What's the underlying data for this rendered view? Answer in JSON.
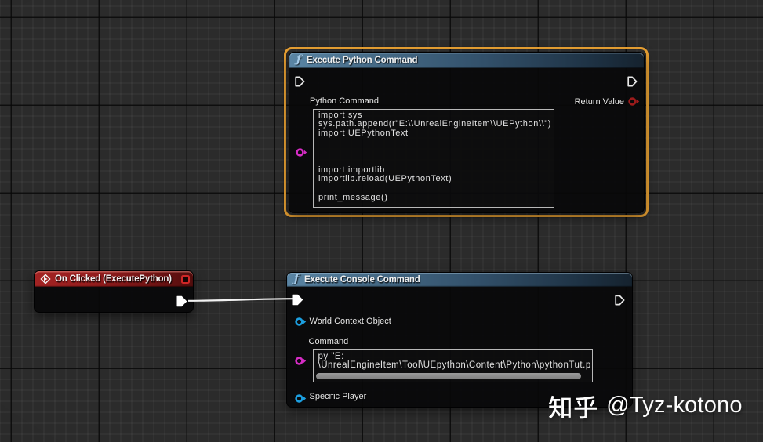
{
  "app": "Unreal Engine Blueprint Graph",
  "nodes": {
    "execute_python": {
      "title": "Execute Python Command",
      "icon": "function-icon",
      "pins": {
        "exec_in": "",
        "exec_out": "",
        "python_command_label": "Python Command",
        "return_value_label": "Return Value"
      },
      "python_command_value_lines": [
        "import sys",
        "sys.path.append(r\"E:\\\\UnrealEngineItem\\\\UEPython\\\\\")",
        "import UEPythonText",
        "",
        "",
        "",
        "import importlib",
        "importlib.reload(UEPythonText)",
        "",
        "print_message()"
      ],
      "selected": true
    },
    "on_clicked": {
      "title": "On Clicked (ExecutePython)",
      "icon": "event-icon"
    },
    "execute_console": {
      "title": "Execute Console Command",
      "icon": "function-icon",
      "pins": {
        "world_context_label": "World Context Object",
        "command_label": "Command",
        "specific_player_label": "Specific Player"
      },
      "command_value_lines": [
        "py \"E:",
        "\\UnrealEngineItem\\Tool\\UEpython\\Content\\Python\\pythonTut.p"
      ]
    }
  },
  "watermark": {
    "cjk": "知乎",
    "handle": " @Tyz-kotono"
  },
  "colors": {
    "selection": "#e9a133",
    "exec_pin": "#ffffff",
    "string_pin": "#d52cc4",
    "object_pin": "#1c9fe0",
    "bool_pin": "#9c1b1b",
    "delegate_pin": "#cf2727",
    "header_function": "#476c88",
    "header_event": "#951d1d",
    "wire": "#f2f2f2"
  }
}
